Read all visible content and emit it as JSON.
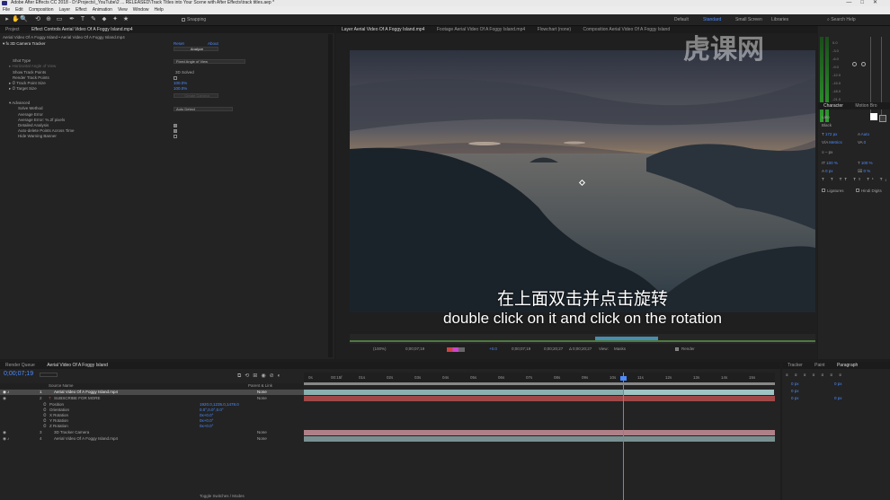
{
  "app": {
    "title": "Adobe After Effects CC 2018 - D:\\Projects\\_YouTube\\2 ... RELEASED\\Track Titles into Your Scene with After Effects\\track titles.aep *",
    "window_controls": [
      "—",
      "□",
      "✕"
    ]
  },
  "menu": [
    "File",
    "Edit",
    "Composition",
    "Layer",
    "Effect",
    "Animation",
    "View",
    "Window",
    "Help"
  ],
  "toolbar": {
    "tools": [
      "▸",
      "✋",
      "🔍",
      "⟲",
      "⊕",
      "▭",
      "✒",
      "T",
      "✎",
      "⬥",
      "✦",
      "★"
    ],
    "snapping_label": "Snapping",
    "workspaces": [
      "Default",
      "Standard",
      "Small Screen",
      "Libraries"
    ],
    "active_workspace": "Standard",
    "search_help": "Search Help"
  },
  "left_panel": {
    "tabs": [
      "Project",
      "Effect Controls Aerial Video Of A Foggy Island.mp4"
    ],
    "layer_path": "Aerial Video Of A Foggy Island • Aerial Video Of A Foggy Island.mp4",
    "effect_name": "3D Camera Tracker",
    "reset": "Reset",
    "about": "About",
    "analyze_button": "Analyze",
    "shot_type_label": "Shot Type",
    "shot_type_value": "Fixed Angle of View",
    "horizontal_angle_label": "Horizontal Angle of View",
    "show_track_points_label": "Show Track Points",
    "show_track_points_value": "3D Solved",
    "render_track_points_label": "Render Track Points",
    "track_point_size_label": "Track Point Size",
    "track_point_size_value": "100.0%",
    "target_size_label": "Target Size",
    "target_size_value": "100.0%",
    "create_camera_button": "Create Camera",
    "advanced_label": "Advanced",
    "solve_method_label": "Solve Method",
    "solve_method_value": "Auto Detect",
    "average_error_label": "Average Error",
    "average_error_value": "Average Error: %.2f pixels",
    "detailed_analysis_label": "Detailed Analysis",
    "auto_delete_label": "Auto-delete Points Across Time",
    "hide_warning_label": "Hide Warning Banner"
  },
  "viewer": {
    "tabs": [
      "Layer  Aerial Video Of A Foggy Island.mp4",
      "Footage  Aerial Video Of A Foggy Island.mp4",
      "Flowchart  (none)",
      "Composition  Aerial Video Of A Foggy Island"
    ],
    "footer": {
      "zoom": "(100%)",
      "timecode": "0;00;07;19",
      "start": "0;00;07;19",
      "end": "0;00;20;27",
      "duration": "Δ 0;00;20;27",
      "view_label": "View:",
      "view_value": "Masks",
      "render_label": "Render",
      "exposure": "+0.0"
    }
  },
  "subtitles": {
    "chinese": "在上面双击并点击旋转",
    "english": "double click on it and click on the rotation"
  },
  "watermark": "虎课网",
  "right_panel": {
    "audio_levels": [
      "0.0",
      "-3.0",
      "-6.0",
      "-9.0",
      "-12.0",
      "-15.0",
      "-18.0",
      "-21.0",
      "-24.0"
    ],
    "tabs": [
      "Character",
      "Motion Bro"
    ],
    "font_label": "Lato",
    "font_style": "Black",
    "font_size": "172 px",
    "leading": "Auto",
    "kerning": "Metrics",
    "tracking": "0",
    "stroke": "– px",
    "vert_scale": "100 %",
    "horiz_scale": "100 %",
    "baseline": "0 px",
    "tsume": "0 %",
    "ligatures": "Ligatures",
    "hindi_digits": "Hindi Digits"
  },
  "timeline": {
    "tabs": [
      "Render Queue",
      "Aerial Video Of A Foggy Island"
    ],
    "timecode": "0;00;07;19",
    "columns": [
      "Source Name",
      "Parent & Link"
    ],
    "ruler": [
      "0s",
      "00:15f",
      "01s",
      "02s",
      "03s",
      "04s",
      "05s",
      "06s",
      "07s",
      "08s",
      "09s",
      "10s",
      "11s",
      "12s",
      "13s",
      "14s",
      "15s"
    ],
    "layers": [
      {
        "num": "1",
        "name": "Aerial Video Of A Foggy Island.mp4",
        "parent": "None",
        "selected": true
      },
      {
        "num": "2",
        "name": "SUBSCRIBE FOR MORE",
        "parent": "None",
        "selected": false
      },
      {
        "num": "",
        "name": "Position",
        "value": "1920.0,1235.0,1478.0"
      },
      {
        "num": "",
        "name": "Orientation",
        "value": "0.0°,0.0°,0.0°"
      },
      {
        "num": "",
        "name": "X Rotation",
        "value": "0x+0.0°"
      },
      {
        "num": "",
        "name": "Y Rotation",
        "value": "0x+0.0°"
      },
      {
        "num": "",
        "name": "Z Rotation",
        "value": "0x+0.0°"
      },
      {
        "num": "3",
        "name": "3D Tracker Camera",
        "parent": "None",
        "selected": false
      },
      {
        "num": "4",
        "name": "Aerial Video Of A Foggy Island.mp4",
        "parent": "None",
        "selected": false
      }
    ],
    "footer_label": "Toggle Switches / Modes"
  },
  "right_bottom": {
    "tabs": [
      "Tracker",
      "Paint",
      "Paragraph"
    ],
    "values": [
      "0 px",
      "0 px",
      "0 px",
      "0 px",
      "0 px"
    ]
  }
}
